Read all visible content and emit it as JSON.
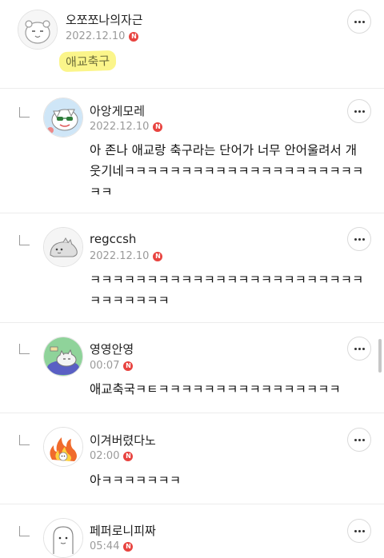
{
  "comments": [
    {
      "nickname": "오쪼쪼나의자근",
      "date": "2022.12.10",
      "new_badge": "N",
      "text": "애교축구",
      "avatar_icon": "hamster-avatar-icon"
    },
    {
      "nickname": "아앙게모레",
      "date": "2022.12.10",
      "new_badge": "N",
      "text": "아 존나 애교랑 축구라는 단어가 너무 안어울려서 개웃기네ㅋㅋㅋㅋㅋㅋㅋㅋㅋㅋㅋㅋㅋㅋㅋㅋㅋㅋㅋㅋㅋㅋㅋ",
      "avatar_icon": "cat-sunglasses-avatar-icon"
    },
    {
      "nickname": "regccsh",
      "date": "2022.12.10",
      "new_badge": "N",
      "text": "ㅋㅋㅋㅋㅋㅋㅋㅋㅋㅋㅋㅋㅋㅋㅋㅋㅋㅋㅋㅋㅋㅋㅋㅋㅋㅋㅋㅋㅋㅋㅋ",
      "avatar_icon": "dinosaur-avatar-icon"
    },
    {
      "nickname": "영영안영",
      "date": "00:07",
      "new_badge": "N",
      "text": "애교축국ㅋㅌㅋㅋㅋㅋㅋㅋㅋㅋㅋㅋㅋㅋㅋㅋㅋㅋ",
      "avatar_icon": "cat-sleeping-avatar-icon"
    },
    {
      "nickname": "이겨버렸다노",
      "date": "02:00",
      "new_badge": "N",
      "text": "아ㅋㅋㅋㅋㅋㅋㅋ",
      "avatar_icon": "fire-avatar-icon"
    },
    {
      "nickname": "페퍼로니피짜",
      "date": "05:44",
      "new_badge": "N",
      "text": "",
      "avatar_icon": "ghost-avatar-icon"
    }
  ],
  "colors": {
    "badge": "#e8433f",
    "highlight": "#fbf58a",
    "date": "#9a9a9a"
  }
}
